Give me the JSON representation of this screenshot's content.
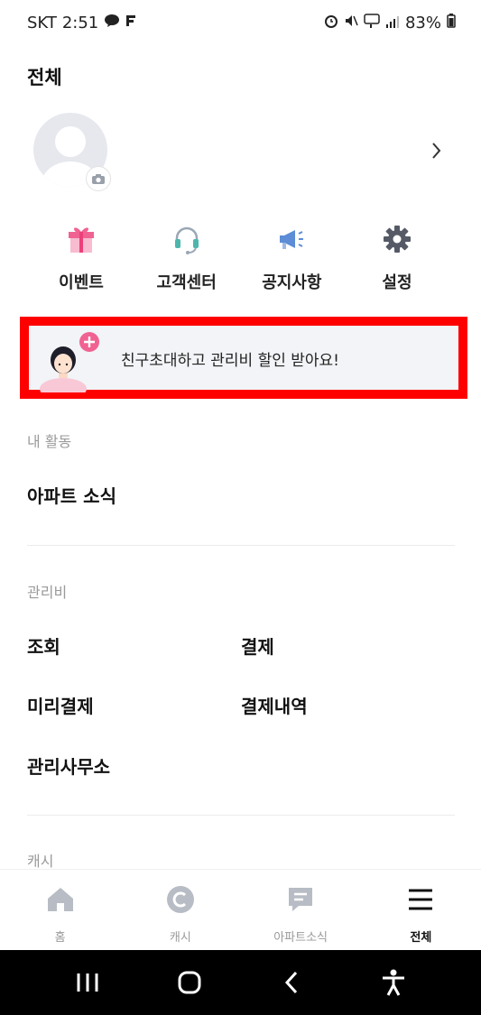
{
  "status_bar": {
    "carrier": "SKT",
    "time": "2:51",
    "battery": "83%",
    "icons": [
      "talk-icon",
      "f-app-icon",
      "alarm-icon",
      "mute-icon",
      "5g-icon",
      "signal-icon",
      "battery-icon"
    ]
  },
  "page_title": "전체",
  "quick_menu": [
    {
      "label": "이벤트",
      "icon": "gift-icon"
    },
    {
      "label": "고객센터",
      "icon": "headset-icon"
    },
    {
      "label": "공지사항",
      "icon": "megaphone-icon"
    },
    {
      "label": "설정",
      "icon": "gear-icon"
    }
  ],
  "invite_banner": {
    "text": "친구초대하고 관리비 할인 받아요!"
  },
  "sections": {
    "my_activity": {
      "title": "내 활동",
      "items": [
        "아파트 소식"
      ]
    },
    "maintenance_fee": {
      "title": "관리비",
      "items": [
        "조회",
        "결제",
        "미리결제",
        "결제내역",
        "관리사무소"
      ]
    },
    "cash": {
      "title": "캐시"
    }
  },
  "bottom_nav": [
    {
      "label": "홈",
      "icon": "home-icon",
      "active": false
    },
    {
      "label": "캐시",
      "icon": "cash-icon",
      "active": false
    },
    {
      "label": "아파트소식",
      "icon": "chat-icon",
      "active": false
    },
    {
      "label": "전체",
      "icon": "menu-icon",
      "active": true
    }
  ],
  "colors": {
    "highlight_border": "#ff0000",
    "banner_bg": "#f2f4f7",
    "gift": "#f06292",
    "headset": "#4db6ac",
    "megaphone": "#5c8dd6",
    "gear": "#555a66",
    "nav_inactive": "#b8bcc4"
  }
}
